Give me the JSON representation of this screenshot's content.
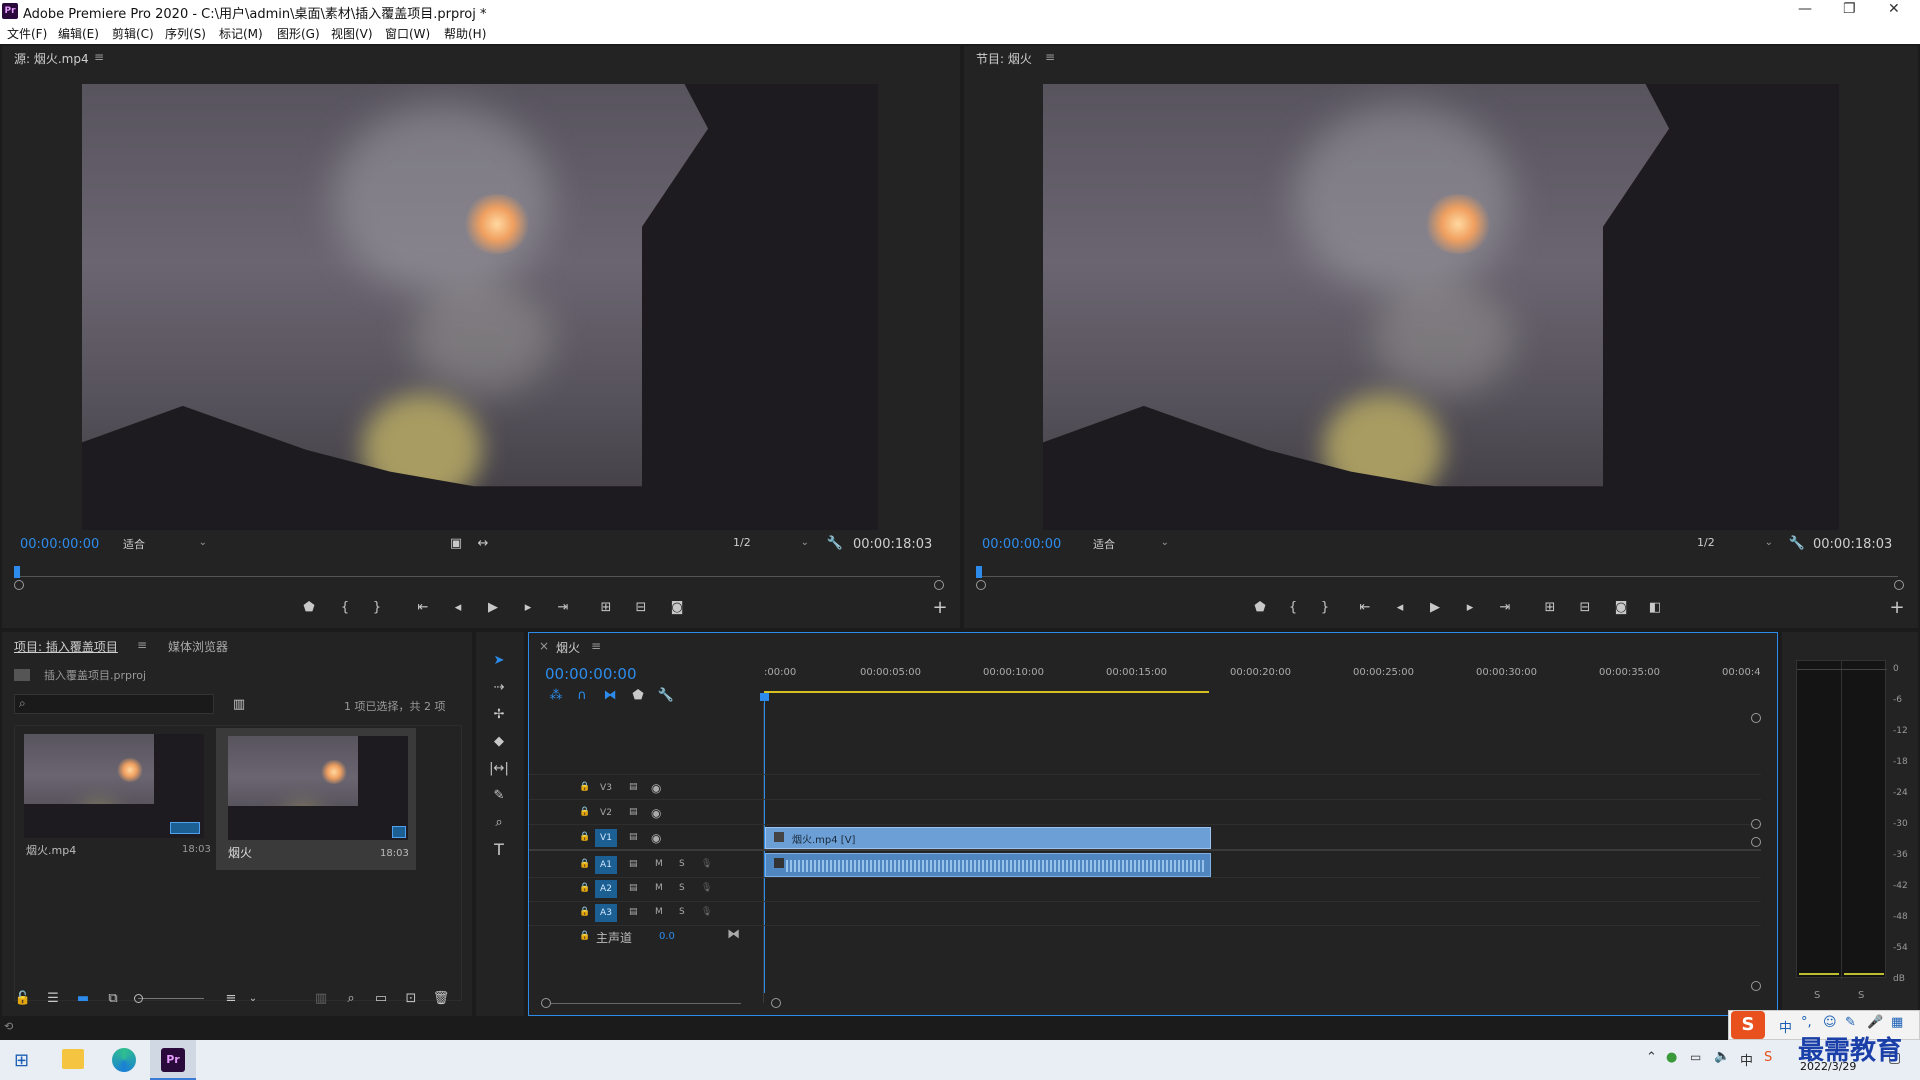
{
  "window": {
    "title": "Adobe Premiere Pro 2020 - C:\\用户\\admin\\桌面\\素材\\插入覆盖项目.prproj *",
    "app_badge": "Pr"
  },
  "menu": [
    "文件(F)",
    "编辑(E)",
    "剪辑(C)",
    "序列(S)",
    "标记(M)",
    "图形(G)",
    "视图(V)",
    "窗口(W)",
    "帮助(H)"
  ],
  "source_monitor": {
    "title": "源: 烟火.mp4",
    "timecode": "00:00:00:00",
    "fit": "适合",
    "resolution": "1/2",
    "duration": "00:00:18:03"
  },
  "program_monitor": {
    "title": "节目: 烟火",
    "timecode": "00:00:00:00",
    "fit": "适合",
    "resolution": "1/2",
    "duration": "00:00:18:03"
  },
  "project": {
    "tab_project": "项目: 插入覆盖项目",
    "tab_media": "媒体浏览器",
    "file": "插入覆盖项目.prproj",
    "selection": "1 项已选择，共 2 项",
    "items": [
      {
        "name": "烟火.mp4",
        "duration": "18:03",
        "selected": false
      },
      {
        "name": "烟火",
        "duration": "18:03",
        "selected": true
      }
    ]
  },
  "timeline": {
    "tab": "烟火",
    "timecode": "00:00:00:00",
    "ruler": [
      ":00:00",
      "00:00:05:00",
      "00:00:10:00",
      "00:00:15:00",
      "00:00:20:00",
      "00:00:25:00",
      "00:00:30:00",
      "00:00:35:00",
      "00:00:4"
    ],
    "video_tracks": [
      "V3",
      "V2",
      "V1"
    ],
    "audio_tracks": [
      "A1",
      "A2",
      "A3"
    ],
    "master_label": "主声道",
    "master_value": "0.0",
    "clip_label": "烟火.mp4 [V]",
    "mute": "M",
    "solo": "S"
  },
  "meter": {
    "scale": [
      "0",
      "-6",
      "-12",
      "-18",
      "-24",
      "-30",
      "-36",
      "-42",
      "-48",
      "-54",
      "dB"
    ],
    "solo_left": "S",
    "solo_right": "S"
  },
  "taskbar": {
    "date": "2022/3/29",
    "ime": "中",
    "watermark": "最需教育"
  }
}
